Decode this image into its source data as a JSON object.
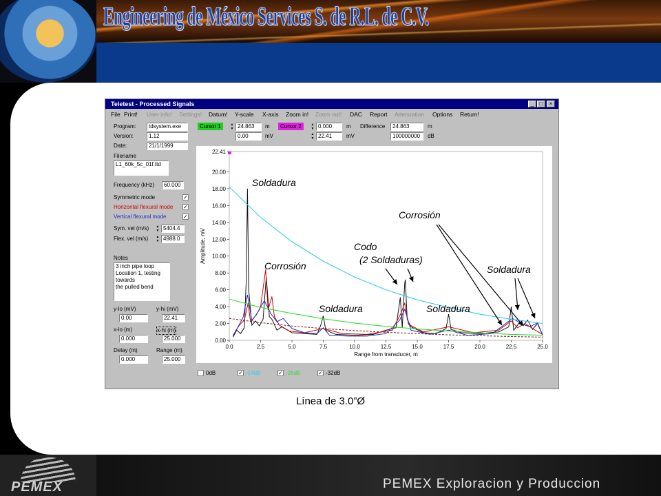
{
  "slide": {
    "company_title": "Engineering de México Services S. de R.L. de C.V.",
    "caption": "Línea de 3.0”Ø",
    "pemex_logo": "PEMEX",
    "footer_text": "PEMEX Exploracion y Produccion",
    "accent_blue": "#0a3a8c"
  },
  "window": {
    "title": "Teletest - Processed Signals",
    "controls": {
      "minimize": "_",
      "maximize": "□",
      "close": "×"
    },
    "menu": [
      {
        "label": "File",
        "enabled": true
      },
      {
        "label": "Print!",
        "enabled": true
      },
      {
        "label": "User info!",
        "enabled": false
      },
      {
        "label": "Settings!",
        "enabled": false
      },
      {
        "label": "Datum!",
        "enabled": true
      },
      {
        "label": "Y-scale",
        "enabled": true
      },
      {
        "label": "X-axis",
        "enabled": true
      },
      {
        "label": "Zoom in!",
        "enabled": true
      },
      {
        "label": "Zoom out!",
        "enabled": false
      },
      {
        "label": "DAC",
        "enabled": true
      },
      {
        "label": "Report",
        "enabled": true
      },
      {
        "label": "Attenuation",
        "enabled": false
      },
      {
        "label": "Options",
        "enabled": true
      },
      {
        "label": "Return!",
        "enabled": true
      }
    ]
  },
  "left_panel": {
    "program_label": "Program:",
    "program": "tdsystem.exe",
    "version_label": "Version:",
    "version": "1.12",
    "date_label": "Date:",
    "date": "21/1/1999",
    "filename_label": "Filename",
    "filename": "L1_60k_5c_01f.ttd",
    "frequency_label": "Frequency (kHz)",
    "frequency": "60.000",
    "symmetric_label": "Symmetric mode",
    "horizontal_label": "Horizontal flexural mode",
    "vertical_label": "Vertical flexural mode",
    "check_mark": "✓",
    "sym_vel_label": "Sym. vel (m/s)",
    "sym_vel": "5404.4",
    "flex_vel_label": "Flex. vel (m/s)",
    "flex_vel": "4988.0",
    "notes_label": "Notes",
    "notes_line1": "3 inch pipe loop",
    "notes_line2": "Location 1, testing towards",
    "notes_line3": "the pulled bend",
    "ylo_label": "y-lo (mV)",
    "ylo": "0.00",
    "yhi_label": "y-hi (mV)",
    "yhi": "22.41",
    "xlo_label": "x-lo (m)",
    "xlo": "0.000",
    "xhi_label": "x-hi (m)",
    "xhi": "25.000",
    "delay_label": "Delay (m)",
    "delay": "0.000",
    "range_label": "Range (m)",
    "range": "25.000"
  },
  "cursor_panel": {
    "cursor1_label": "Cursor 1",
    "cursor1_color": "#22cc22",
    "cursor1_pos": "24.863",
    "cursor1_mv": "0.00",
    "cursor2_label": "Cursor 2",
    "cursor2_color": "#dd22dd",
    "cursor2_pos": "0.000",
    "cursor2_mv": "22.41",
    "unit_m": "m",
    "unit_mv": "mV",
    "unit_db": "dB",
    "difference_label": "Difference",
    "difference": "24.863",
    "difference_db": "100000000"
  },
  "gain_options": [
    {
      "label": "0dB",
      "checked": false,
      "color": "#000000"
    },
    {
      "label": "-14dB",
      "checked": true,
      "color": "#33ccee"
    },
    {
      "label": "-26dB",
      "checked": true,
      "color": "#33dd33"
    },
    {
      "label": "-32dB",
      "checked": true,
      "color": "#000000"
    }
  ],
  "annotations": {
    "weld1": "Soldadura",
    "corrosion1": "Corrosión",
    "weld2": "Soldadura",
    "elbow": "Codo",
    "elbow_welds": "(2 Soldaduras)",
    "weld3": "Soldadura",
    "corrosion2": "Corrosión",
    "weld4": "Soldadura"
  },
  "chart_data": {
    "type": "line",
    "xlabel": "Range from transducer, m",
    "ylabel": "Amplitude, mV",
    "xlim": [
      0,
      25
    ],
    "ylim": [
      0,
      22.41
    ],
    "x_ticks": [
      "0.0",
      "2.5",
      "5.0",
      "7.5",
      "10.0",
      "12.5",
      "15.0",
      "17.5",
      "20.0",
      "22.5",
      "25.0"
    ],
    "y_ticks": [
      "0.00",
      "2.00",
      "4.00",
      "6.00",
      "8.00",
      "10.00",
      "12.00",
      "14.00",
      "16.00",
      "18.00",
      "20.00",
      "22.41"
    ],
    "top_value_label": "22.41",
    "series": [
      {
        "color": "#111111",
        "x": [
          0.3,
          0.6,
          0.9,
          1.2,
          1.35,
          1.45,
          1.55,
          1.8,
          2.1,
          2.4,
          2.7,
          2.95,
          3.2,
          3.4,
          3.8,
          4.2,
          5.0,
          6.0,
          7.0,
          7.3,
          7.5,
          7.7,
          8.5,
          10.0,
          11.5,
          12.5,
          13.3,
          13.65,
          13.8,
          14.0,
          14.05,
          14.2,
          14.5,
          15.5,
          16.5,
          17.3,
          17.5,
          17.7,
          18.5,
          20.0,
          21.5,
          22.3,
          22.5,
          22.7,
          23.2,
          23.5,
          23.8,
          24.2,
          24.6,
          25.0
        ],
        "y": [
          0.4,
          1.2,
          0.8,
          1.5,
          7.0,
          18.0,
          6.0,
          1.8,
          2.3,
          1.7,
          2.5,
          7.5,
          2.8,
          2.5,
          1.2,
          1.6,
          0.9,
          0.8,
          0.7,
          1.8,
          2.9,
          1.2,
          0.7,
          0.6,
          0.7,
          1.2,
          1.5,
          5.1,
          1.5,
          6.8,
          7.2,
          2.5,
          1.6,
          0.9,
          0.8,
          1.4,
          3.1,
          1.3,
          0.9,
          0.8,
          1.0,
          1.6,
          4.0,
          1.2,
          2.2,
          1.8,
          2.4,
          1.3,
          2.0,
          0.6
        ]
      },
      {
        "color": "#cc0000",
        "x": [
          0.3,
          0.8,
          1.2,
          1.5,
          1.7,
          2.2,
          2.5,
          2.9,
          3.1,
          3.4,
          3.6,
          4.0,
          4.8,
          6.0,
          7.5,
          9.0,
          11.0,
          13.0,
          13.7,
          14.0,
          14.3,
          15.5,
          17.5,
          19.5,
          21.5,
          22.5,
          23.0,
          23.6,
          24.2,
          25.0
        ],
        "y": [
          0.6,
          1.8,
          2.4,
          4.4,
          2.2,
          3.1,
          4.0,
          8.4,
          3.6,
          5.2,
          2.8,
          1.8,
          1.1,
          0.9,
          1.4,
          0.8,
          0.7,
          1.2,
          3.2,
          4.4,
          1.9,
          1.0,
          1.6,
          0.9,
          1.2,
          2.3,
          1.5,
          2.0,
          1.4,
          0.7
        ]
      },
      {
        "color": "#1f2fbf",
        "x": [
          0.3,
          0.7,
          1.1,
          1.45,
          1.8,
          2.3,
          2.8,
          3.3,
          3.8,
          4.3,
          5.0,
          6.0,
          7.0,
          7.5,
          8.0,
          9.5,
          11.0,
          12.5,
          13.6,
          14.0,
          14.5,
          16.0,
          17.5,
          19.0,
          21.0,
          22.6,
          23.4,
          24.0,
          24.6,
          25.0
        ],
        "y": [
          0.5,
          1.6,
          2.7,
          5.4,
          2.3,
          3.4,
          4.7,
          3.2,
          2.2,
          2.6,
          1.4,
          0.9,
          0.8,
          1.5,
          0.6,
          0.5,
          0.5,
          0.8,
          2.4,
          3.7,
          1.2,
          0.7,
          1.2,
          0.6,
          0.8,
          2.6,
          1.9,
          1.6,
          2.1,
          0.6
        ]
      },
      {
        "color": "#33ccee",
        "x": [
          0,
          2.5,
          5.0,
          7.5,
          10.0,
          12.5,
          15.0,
          17.5,
          20.0,
          22.5,
          25.0
        ],
        "y": [
          18.2,
          14.6,
          11.7,
          9.4,
          7.5,
          6.0,
          4.8,
          3.9,
          3.1,
          2.5,
          2.0
        ]
      },
      {
        "color": "#33dd33",
        "x": [
          0,
          2.5,
          5.0,
          7.5,
          10.0,
          12.5,
          15.0,
          17.5,
          20.0,
          22.5,
          25.0
        ],
        "y": [
          4.9,
          3.9,
          3.2,
          2.55,
          2.05,
          1.65,
          1.35,
          1.1,
          0.9,
          0.7,
          0.6
        ]
      },
      {
        "color": "#7a2a2a",
        "x": [
          0,
          2.5,
          5.0,
          7.5,
          10.0,
          12.5,
          15.0,
          17.5,
          20.0,
          22.5,
          25.0
        ],
        "y": [
          2.6,
          2.1,
          1.7,
          1.4,
          1.15,
          0.95,
          0.8,
          0.65,
          0.55,
          0.45,
          0.38
        ]
      }
    ]
  }
}
